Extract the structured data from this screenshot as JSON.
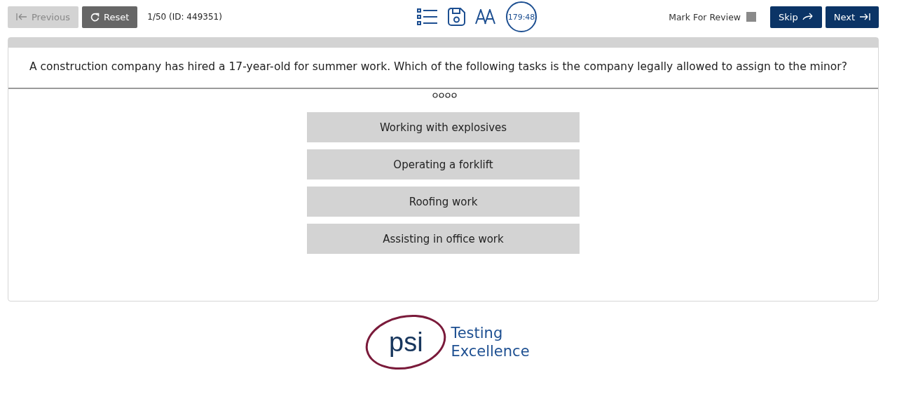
{
  "toolbar": {
    "previous": {
      "label": "Previous",
      "disabled": true
    },
    "reset": {
      "label": "Reset"
    },
    "progress": "1/50 (ID: 449351)",
    "timer": "179:48",
    "mark_for_review": {
      "label": "Mark For Review",
      "checked": false
    },
    "skip": {
      "label": "Skip"
    },
    "next": {
      "label": "Next"
    }
  },
  "question": {
    "text": "A construction company has hired a 17-year-old for summer work. Which of the following tasks is the company legally allowed to assign to the minor?",
    "options": [
      {
        "label": "Working with explosives",
        "selected": false
      },
      {
        "label": "Operating a forklift",
        "selected": false
      },
      {
        "label": "Roofing work",
        "selected": false
      },
      {
        "label": "Assisting in office work",
        "selected": false
      }
    ]
  },
  "footer": {
    "logo_mark": "psi",
    "tagline_1": "Testing",
    "tagline_2": "Excellence"
  }
}
